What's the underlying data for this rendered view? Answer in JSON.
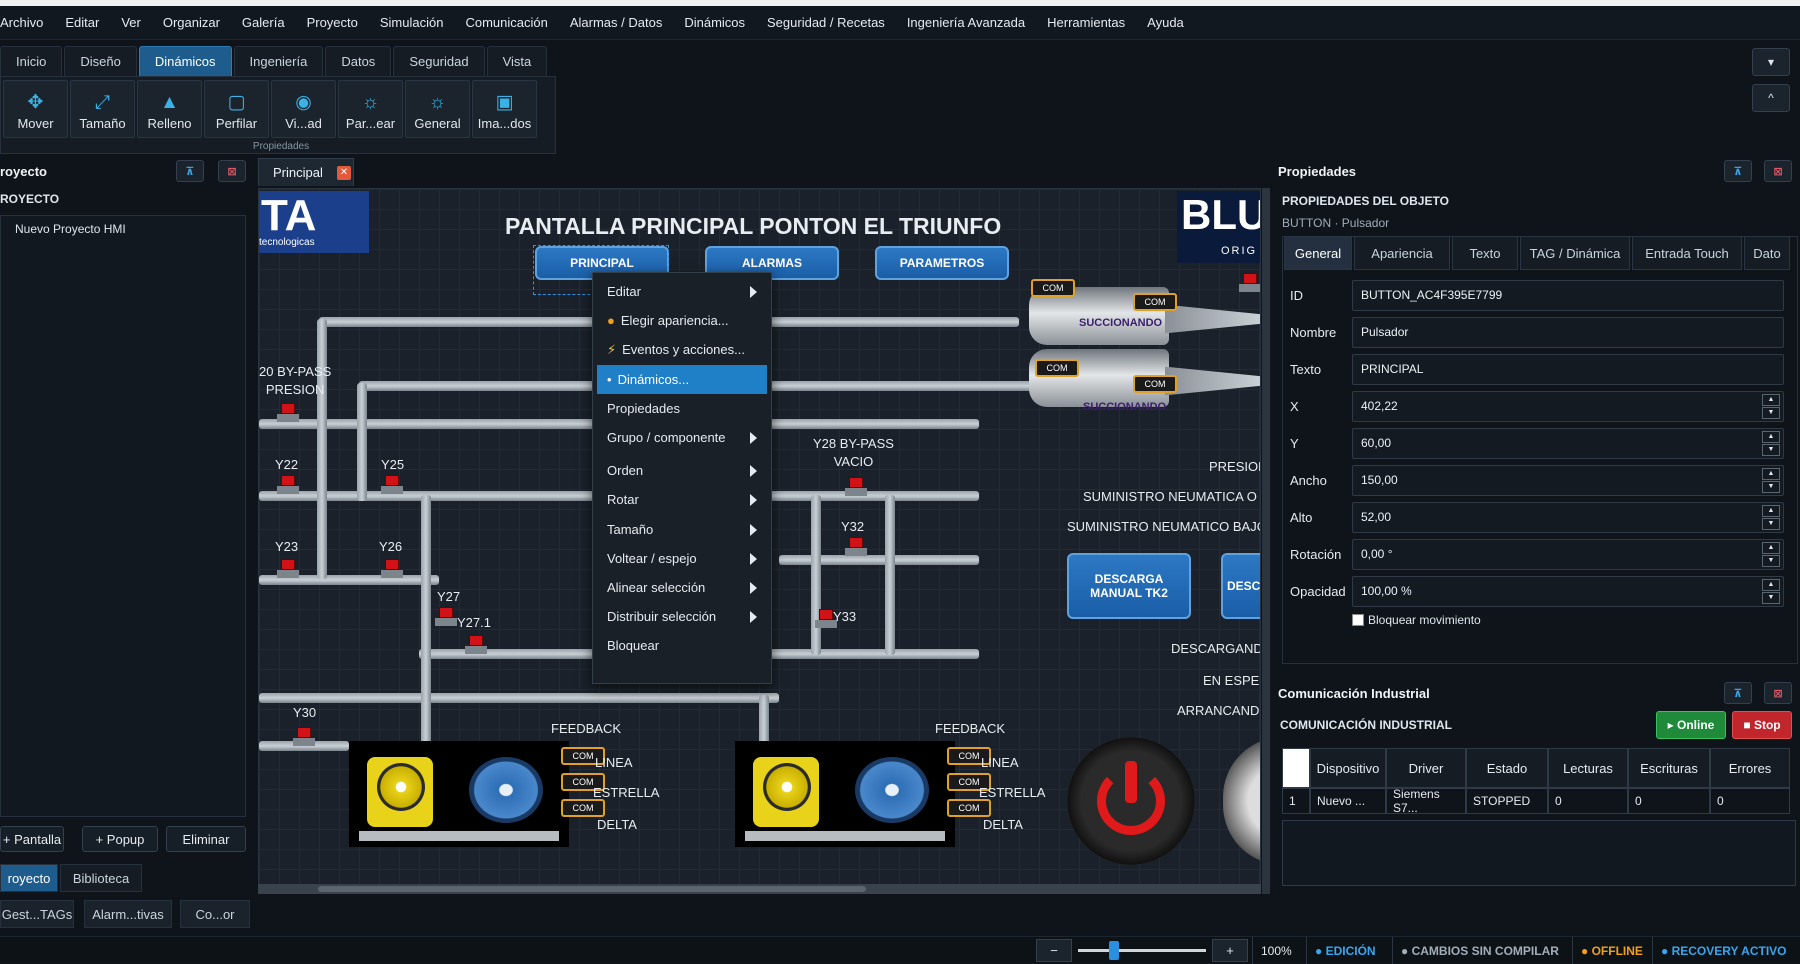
{
  "menubar": {
    "items": [
      "Archivo",
      "Editar",
      "Ver",
      "Organizar",
      "Galería",
      "Proyecto",
      "Simulación",
      "Comunicación",
      "Alarmas / Datos",
      "Dinámicos",
      "Seguridad / Recetas",
      "Ingeniería Avanzada",
      "Herramientas",
      "Ayuda"
    ]
  },
  "ribbon": {
    "tabs": [
      "Inicio",
      "Diseño",
      "Dinámicos",
      "Ingeniería",
      "Datos",
      "Seguridad",
      "Vista"
    ],
    "active_tab": "Dinámicos",
    "tools": [
      {
        "label": "Mover",
        "icon": "move-icon"
      },
      {
        "label": "Tamaño",
        "icon": "resize-icon"
      },
      {
        "label": "Relleno",
        "icon": "fill-icon"
      },
      {
        "label": "Perfilar",
        "icon": "outline-icon"
      },
      {
        "label": "Vi...ad",
        "icon": "eye-icon"
      },
      {
        "label": "Par...ear",
        "icon": "sun-icon"
      },
      {
        "label": "General",
        "icon": "sun-icon"
      },
      {
        "label": "Ima...dos",
        "icon": "image-icon"
      }
    ],
    "group_label": "Propiedades",
    "ctrl_dropdown": "▾",
    "ctrl_collapse": "^"
  },
  "left_panel": {
    "header": "royecto",
    "tree_root": "ROYECTO",
    "tree_items": [
      "Nuevo Proyecto HMI"
    ],
    "buttons": {
      "add_screen": "+ Pantalla",
      "add_popup": "+ Popup",
      "delete": "Eliminar"
    },
    "tabs": [
      "royecto",
      "Biblioteca"
    ],
    "bottom_buttons": [
      "Gest...TAGs",
      "Alarm...tivas",
      "Co...or"
    ]
  },
  "document": {
    "tab_label": "Principal",
    "close": "✕"
  },
  "canvas": {
    "title": "PANTALLA PRINCIPAL PONTON EL TRIUNFO",
    "logo_left": "TA",
    "logo_left_sub": "tecnologicas",
    "logo_right": "BLU",
    "logo_right_sub": "ORIG",
    "nav_buttons": [
      "PRINCIPAL",
      "ALARMAS",
      "PARAMETROS"
    ],
    "valve_labels": {
      "y20": "20 BY-PASS\nPRESION",
      "y22": "Y22",
      "y25": "Y25",
      "y23": "Y23",
      "y26": "Y26",
      "y27": "Y27",
      "y271": "Y27.1",
      "y28": "Y28 BY-PASS\nVACIO",
      "y32": "Y32",
      "y33": "Y33",
      "y30": "Y30"
    },
    "status_labels": {
      "presion": "PRESION",
      "sum_alto": "SUMINISTRO NEUMATICA O",
      "sum_bajo": "SUMINISTRO NEUMATICO BAJO",
      "descargando": "DESCARGAND",
      "espera": "EN ESPER",
      "arrancando": "ARRANCAND"
    },
    "tank_labels": [
      "SUCCIONANDO",
      "SUCCIONANDO"
    ],
    "com_label": "COM",
    "descarga_btns": [
      "DESCARGA MANUAL\nTK2",
      "DESCA"
    ],
    "feedback": {
      "title": "FEEDBACK",
      "items": [
        "LINEA",
        "ESTRELLA",
        "DELTA"
      ]
    }
  },
  "context_menu": {
    "items": [
      {
        "label": "Editar",
        "submenu": true
      },
      {
        "label": "Elegir apariencia...",
        "icon": "palette-icon"
      },
      {
        "label": "Eventos y acciones...",
        "icon": "lightning-icon"
      },
      {
        "label": "Dinámicos...",
        "icon": "dot-icon",
        "highlight": true
      },
      {
        "label": "Propiedades"
      },
      {
        "label": "Grupo / componente",
        "submenu": true
      },
      {
        "label": "Orden",
        "submenu": true
      },
      {
        "label": "Rotar",
        "submenu": true
      },
      {
        "label": "Tamaño",
        "submenu": true
      },
      {
        "label": "Voltear / espejo",
        "submenu": true
      },
      {
        "label": "Alinear selección",
        "submenu": true
      },
      {
        "label": "Distribuir selección",
        "submenu": true
      },
      {
        "label": "Bloquear"
      }
    ]
  },
  "properties": {
    "panel_title": "Propiedades",
    "section": "PROPIEDADES DEL OBJETO",
    "subtitle": "BUTTON · Pulsador",
    "tabs": [
      "General",
      "Apariencia",
      "Texto",
      "TAG / Dinámica",
      "Entrada Touch",
      "Dato"
    ],
    "fields": [
      {
        "label": "ID",
        "value": "BUTTON_AC4F395E7799",
        "spin": false
      },
      {
        "label": "Nombre",
        "value": "Pulsador",
        "spin": false
      },
      {
        "label": "Texto",
        "value": "PRINCIPAL",
        "spin": false
      },
      {
        "label": "X",
        "value": "402,22",
        "spin": true
      },
      {
        "label": "Y",
        "value": "60,00",
        "spin": true
      },
      {
        "label": "Ancho",
        "value": "150,00",
        "spin": true
      },
      {
        "label": "Alto",
        "value": "52,00",
        "spin": true
      },
      {
        "label": "Rotación",
        "value": "0,00 °",
        "spin": true
      },
      {
        "label": "Opacidad",
        "value": "100,00 %",
        "spin": true
      }
    ],
    "lock_label": "Bloquear movimiento"
  },
  "comm": {
    "panel_title": "Comunicación Industrial",
    "section": "COMUNICACIÓN INDUSTRIAL",
    "online": "▸ Online",
    "stop": "■ Stop",
    "columns": [
      "",
      "Dispositivo",
      "Driver",
      "Estado",
      "Lecturas",
      "Escrituras",
      "Errores"
    ],
    "rows": [
      [
        "1",
        "Nuevo ...",
        "Siemens S7...",
        "STOPPED",
        "0",
        "0",
        "0"
      ]
    ]
  },
  "statusbar": {
    "minus": "−",
    "plus": "+",
    "zoom": "100%",
    "mode": "● EDICIÓN",
    "changes": "● CAMBIOS SIN COMPILAR",
    "offline": "● OFFLINE",
    "recovery": "● RECOVERY ACTIVO",
    "colors": {
      "mode": "#3aa6ee",
      "changes": "#a3adb8",
      "offline": "#f0a020",
      "recovery": "#3aa6ee"
    },
    "zoom_slider": 0.28
  }
}
